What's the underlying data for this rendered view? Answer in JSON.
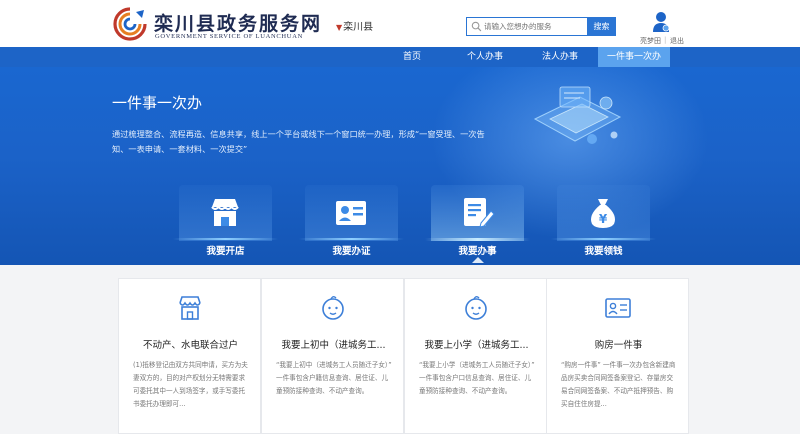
{
  "header": {
    "logo_cn": "栾川县政务服务网",
    "logo_en": "GOVERNMENT SERVICE OF LUANCHUAN",
    "region": "栾川县",
    "search_placeholder": "请输入您想办的服务",
    "search_button": "搜索",
    "user_name": "亮梦田",
    "user_separator": "|",
    "logout": "退出"
  },
  "nav": {
    "items": [
      {
        "label": "首页",
        "active": false
      },
      {
        "label": "个人办事",
        "active": false
      },
      {
        "label": "法人办事",
        "active": false
      },
      {
        "label": "一件事一次办",
        "active": true
      }
    ]
  },
  "banner": {
    "title": "一件事一次办",
    "description": "通过梳理整合、流程再造、信息共享，线上一个平台或线下一个窗口统一办理，形成“一窗受理、一次告知、一表申请、一套材料、一次提交”"
  },
  "tiles": [
    {
      "label": "我要开店",
      "icon": "shop-icon",
      "active": false
    },
    {
      "label": "我要办证",
      "icon": "id-card-icon",
      "active": false
    },
    {
      "label": "我要办事",
      "icon": "document-edit-icon",
      "active": true
    },
    {
      "label": "我要领钱",
      "icon": "money-bag-icon",
      "active": false
    }
  ],
  "cards": [
    {
      "title": "不动产、水电联合过户",
      "icon": "shop-icon",
      "desc": "(1)抵移登记由双方共同申请，买方为夫妻双方的，目的对产权划分无特需要求可委托其中一人到场签字，或手写委托书委托办理即可..."
    },
    {
      "title": "我要上初中（进城务工...",
      "icon": "baby-icon",
      "desc": "“我要上初中（进城务工人员随迁子女）” 一件事包含户籍信息查询、居住证、儿童预防接种查询、不动产查询。"
    },
    {
      "title": "我要上小学（进城务工...",
      "icon": "baby-icon",
      "desc": "“我要上小学（进城务工人员随迁子女）” 一件事包含户口信息查询、居住证、儿童预防接种查询、不动产查询。"
    },
    {
      "title": "购房一件事",
      "icon": "id-card-icon",
      "desc": "“购房一件事” 一件事一次办包含新建商品房买卖合同网签备案登记、存量房交易合同网签备案、不动产抵押预告、购买自住住房提..."
    }
  ],
  "colors": {
    "nav_bg": "#1d64c7",
    "nav_active": "#5ba3ee",
    "banner_bg": "#1a67d0",
    "accent": "#2a75d4",
    "logo_red": "#c0392b"
  }
}
